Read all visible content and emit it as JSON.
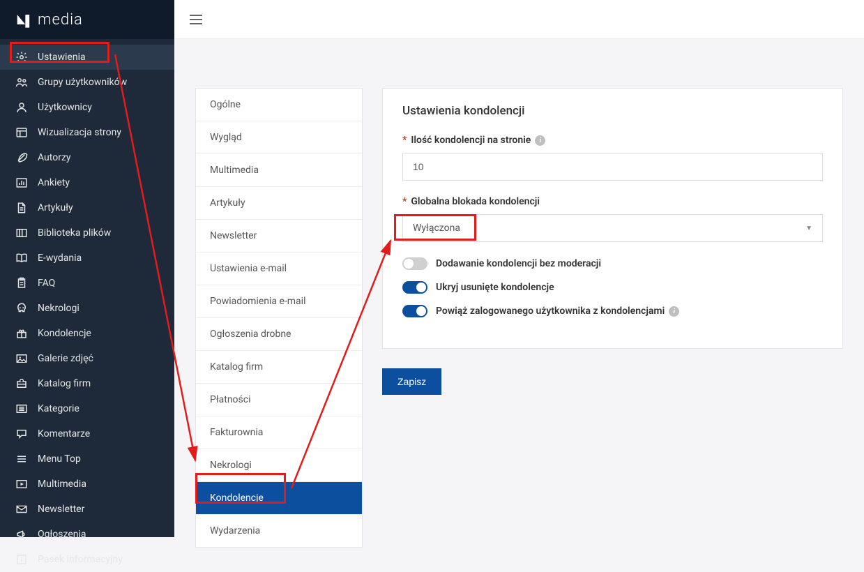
{
  "brand": {
    "name": "media"
  },
  "sidebar": {
    "items": [
      {
        "label": "Ustawienia",
        "icon": "gear",
        "active": true
      },
      {
        "label": "Grupy użytkowników",
        "icon": "users"
      },
      {
        "label": "Użytkownicy",
        "icon": "user"
      },
      {
        "label": "Wizualizacja strony",
        "icon": "layout"
      },
      {
        "label": "Autorzy",
        "icon": "feather"
      },
      {
        "label": "Ankiety",
        "icon": "chart"
      },
      {
        "label": "Artykuły",
        "icon": "file"
      },
      {
        "label": "Biblioteka plików",
        "icon": "library"
      },
      {
        "label": "E-wydania",
        "icon": "book"
      },
      {
        "label": "FAQ",
        "icon": "clipboard"
      },
      {
        "label": "Nekrologi",
        "icon": "skull"
      },
      {
        "label": "Kondolencje",
        "icon": "gift"
      },
      {
        "label": "Galerie zdjęć",
        "icon": "image"
      },
      {
        "label": "Katalog firm",
        "icon": "briefcase"
      },
      {
        "label": "Kategorie",
        "icon": "list"
      },
      {
        "label": "Komentarze",
        "icon": "comment"
      },
      {
        "label": "Menu Top",
        "icon": "menu"
      },
      {
        "label": "Multimedia",
        "icon": "play"
      },
      {
        "label": "Newsletter",
        "icon": "mail"
      },
      {
        "label": "Ogłoszenia",
        "icon": "megaphone"
      },
      {
        "label": "Pasek informacyjny",
        "icon": "info"
      }
    ]
  },
  "settings_tabs": [
    "Ogólne",
    "Wygląd",
    "Multimedia",
    "Artykuły",
    "Newsletter",
    "Ustawienia e-mail",
    "Powiadomienia e-mail",
    "Ogłoszenia drobne",
    "Katalog firm",
    "Płatności",
    "Fakturownia",
    "Nekrologi",
    "Kondolencje",
    "Wydarzenia"
  ],
  "settings_active_tab": "Kondolencje",
  "panel": {
    "title": "Ustawienia kondolencji",
    "count_label": "Ilość kondolencji na stronie",
    "count_value": "10",
    "block_label": "Globalna blokada kondolencji",
    "block_value": "Wyłączona",
    "toggle1": "Dodawanie kondolencji bez moderacji",
    "toggle2": "Ukryj usunięte kondolencje",
    "toggle3": "Powiąż zalogowanego użytkownika z kondolencjami",
    "save": "Zapisz"
  }
}
